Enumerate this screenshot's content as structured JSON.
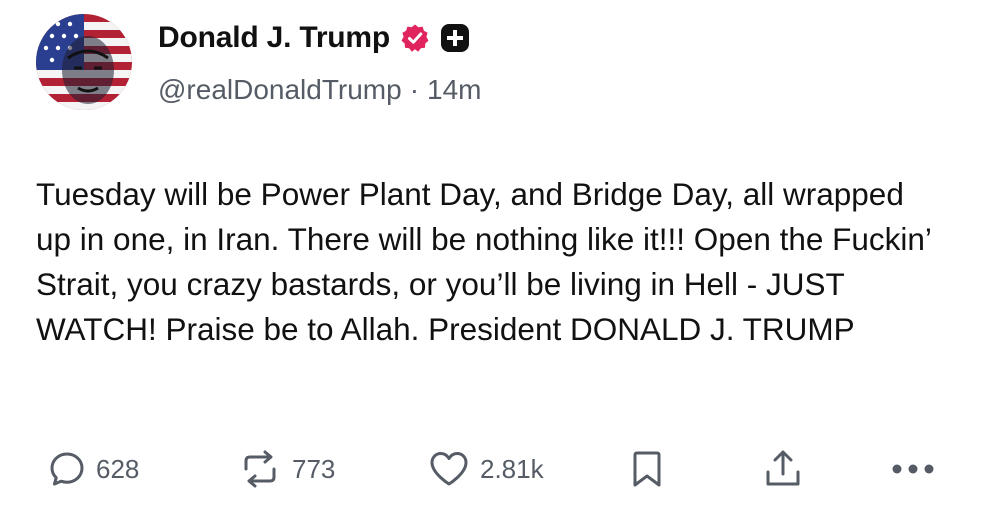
{
  "author": {
    "display_name": "Donald J. Trump",
    "handle": "@realDonaldTrump",
    "separator": "·",
    "time_ago": "14m",
    "verified_color": "#e0245e",
    "avatar_icon": "american-flag-portrait"
  },
  "post": {
    "text": "Tuesday will be Power Plant Day, and Bridge Day, all wrapped up in one, in Iran. There will be nothing like it!!! Open the Fuckin’ Strait, you crazy bastards, or you’ll be living in Hell - JUST WATCH! Praise be to Allah. President DONALD J. TRUMP"
  },
  "actions": {
    "reply_count": "628",
    "repost_count": "773",
    "like_count": "2.81k",
    "icons": [
      "reply-icon",
      "repost-icon",
      "heart-icon",
      "bookmark-icon",
      "share-icon",
      "more-icon"
    ]
  },
  "colors": {
    "text": "#111111",
    "muted": "#555c66",
    "accent_verified": "#e0245e"
  }
}
